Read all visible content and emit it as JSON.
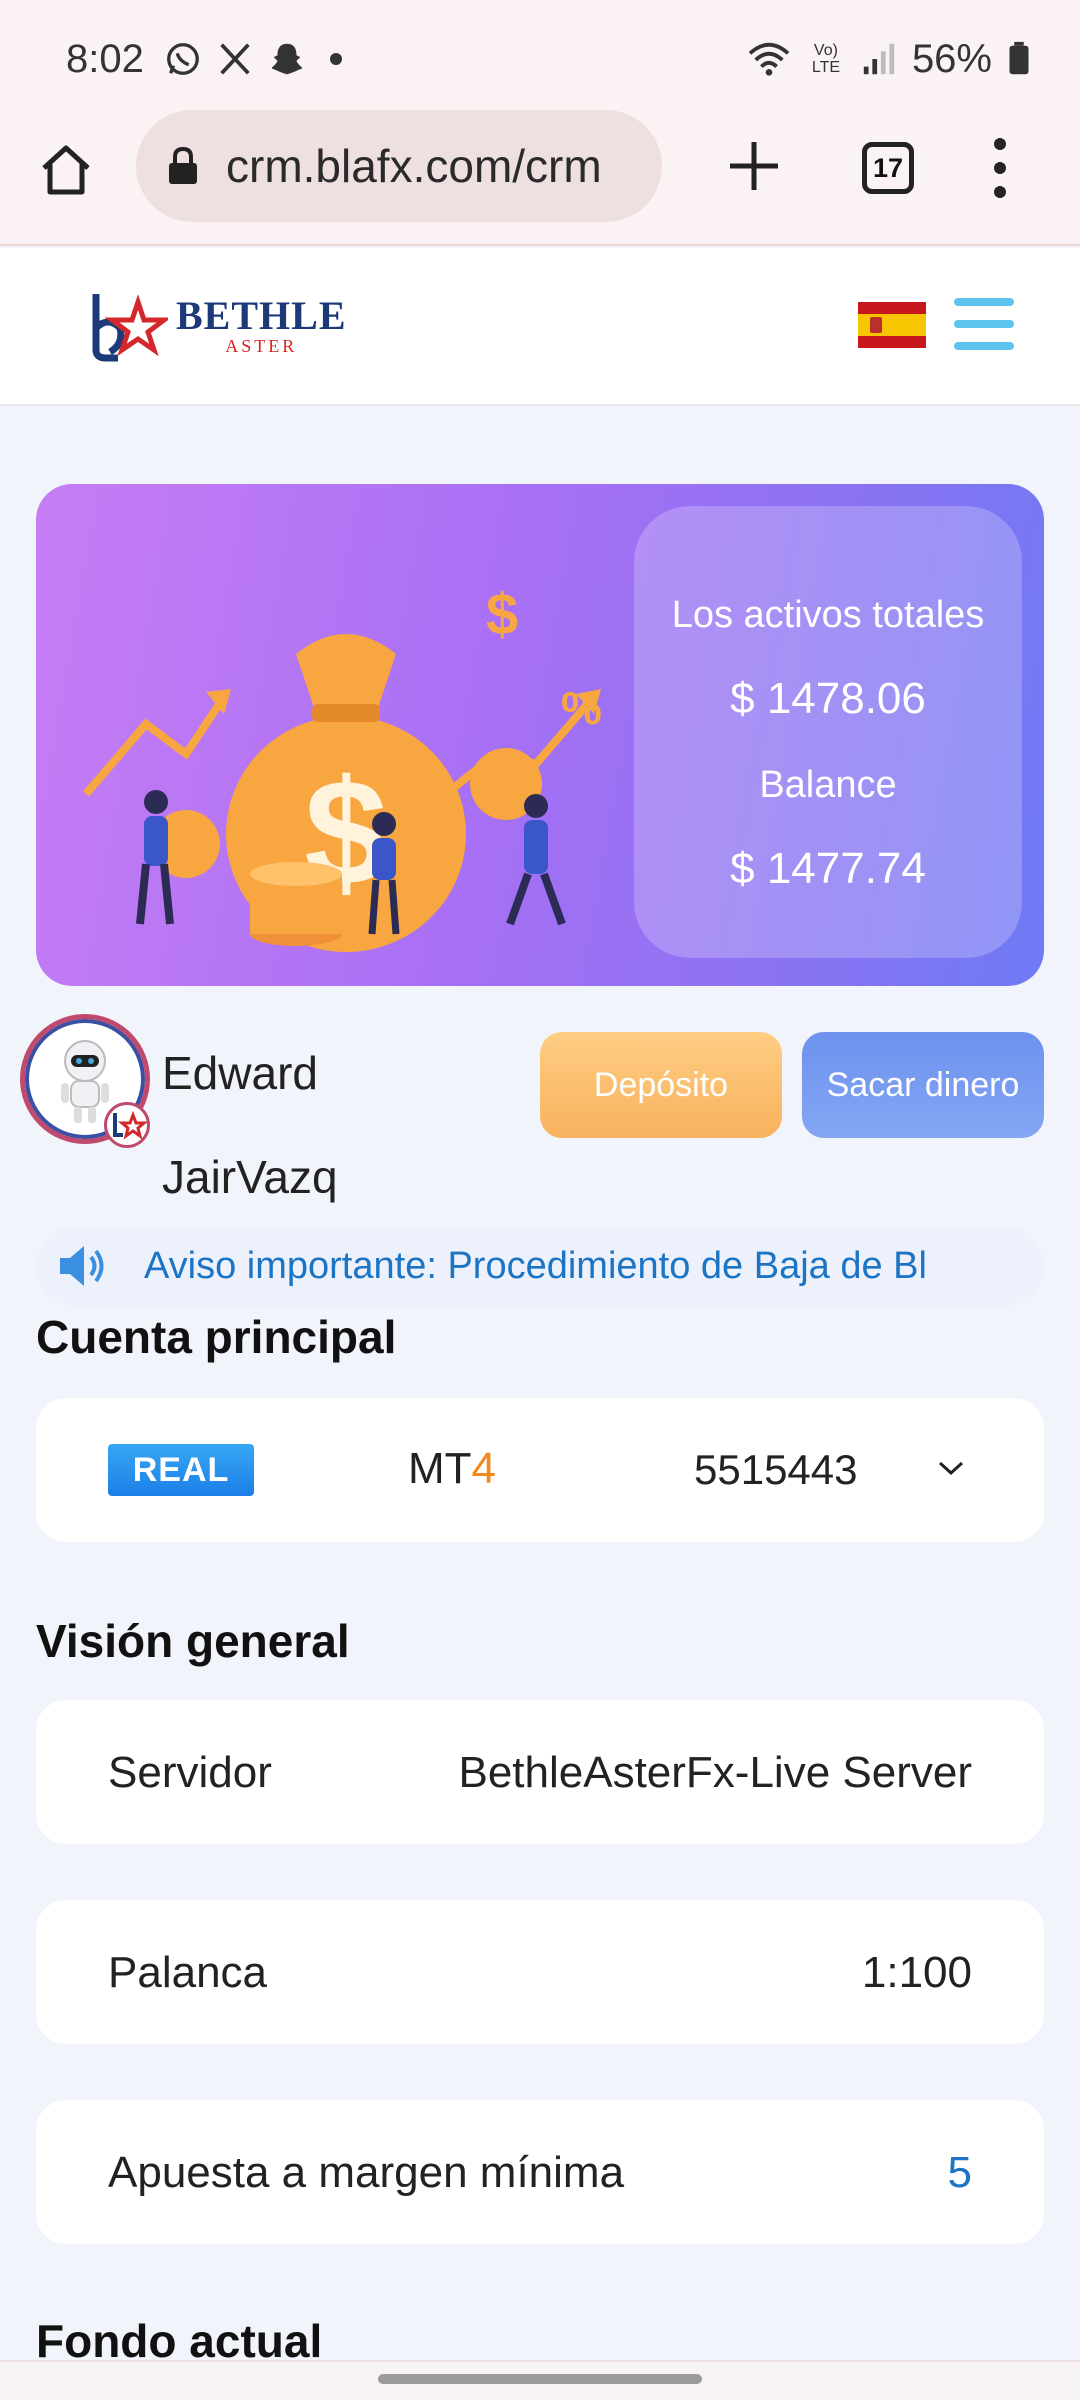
{
  "status_bar": {
    "time": "8:02",
    "network_label": "Vo) LTE",
    "battery": "56%"
  },
  "browser": {
    "url": "crm.blafx.com/crm",
    "tab_count": "17"
  },
  "header": {
    "logo_line1": "BETHLE",
    "logo_line2": "ASTER"
  },
  "banner": {
    "total_assets_label": "Los activos totales",
    "total_assets_value": "$ 1478.06",
    "balance_label": "Balance",
    "balance_value": "$ 1477.74"
  },
  "user": {
    "first_name": "Edward",
    "last_name": "JairVazq"
  },
  "actions": {
    "deposit_label": "Depósito",
    "withdraw_label": "Sacar dinero"
  },
  "notice": {
    "text": "Aviso importante: Procedimiento de Baja de Bl"
  },
  "main_account": {
    "title": "Cuenta principal",
    "type_badge": "REAL",
    "platform_prefix": "MT",
    "platform_number": "4",
    "account_number": "5515443"
  },
  "overview": {
    "title": "Visión general",
    "rows": [
      {
        "label": "Servidor",
        "value": "BethleAsterFx-Live Server"
      },
      {
        "label": "Palanca",
        "value": "1:100"
      },
      {
        "label": "Apuesta a margen mínima",
        "value": "5"
      }
    ]
  },
  "current_fund": {
    "title": "Fondo actual"
  },
  "colors": {
    "accent_blue": "#1c74c4",
    "deposit_orange": "#f8b25e",
    "withdraw_blue": "#6d92ee",
    "banner_purple": "#a870f5"
  }
}
